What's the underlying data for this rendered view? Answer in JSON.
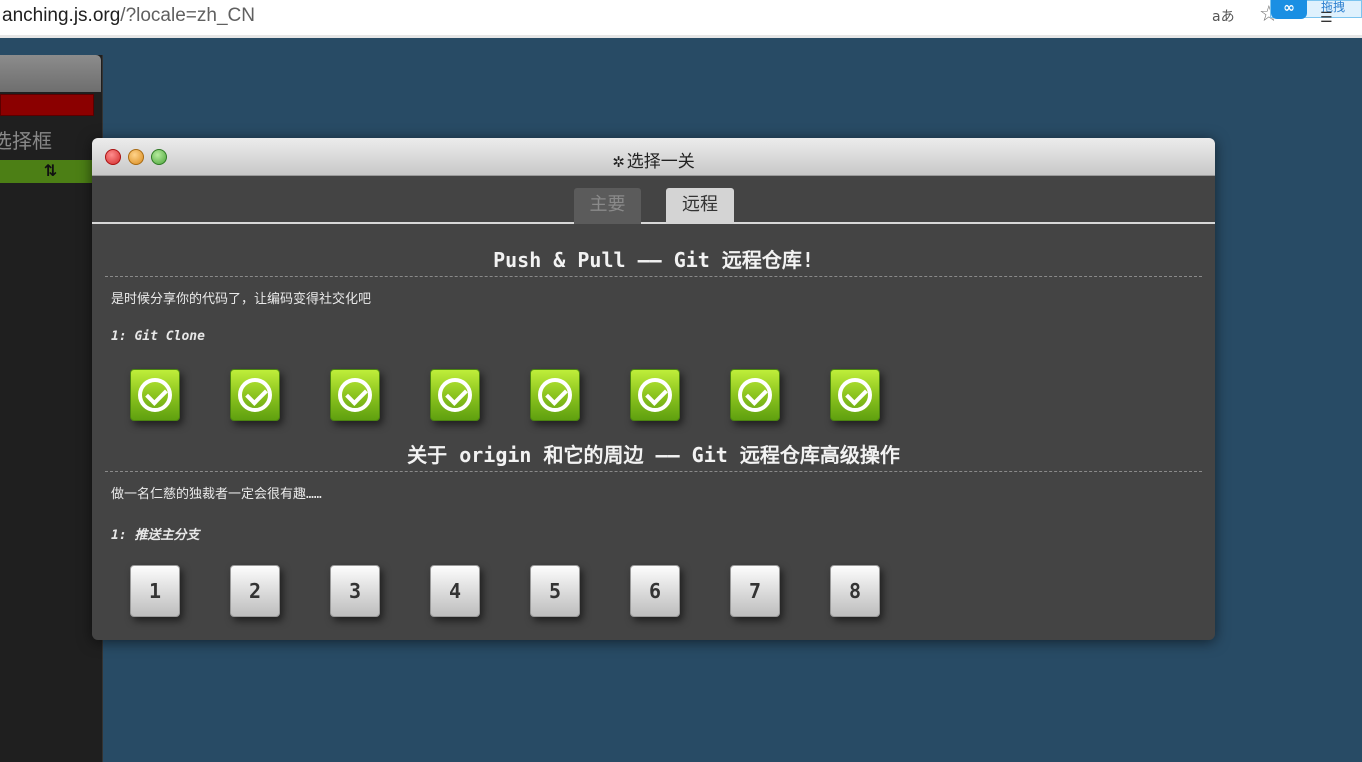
{
  "browser": {
    "url_host": "anching.js.org",
    "url_rest": "/?locale=zh_CN",
    "reader_icon": "aあ",
    "ext_text": "拖拽"
  },
  "left_panel": {
    "label": "选择框",
    "action_icon": "⇅"
  },
  "modal": {
    "title": "选择一关",
    "tabs": [
      {
        "label": "主要",
        "active": false
      },
      {
        "label": "远程",
        "active": true
      }
    ],
    "sections": [
      {
        "title": "Push & Pull —— Git 远程仓库!",
        "description": "是时候分享你的代码了，让编码变得社交化吧",
        "sequence": "1: Git Clone",
        "levels": [
          {
            "label": "1",
            "completed": true
          },
          {
            "label": "2",
            "completed": true
          },
          {
            "label": "3",
            "completed": true
          },
          {
            "label": "4",
            "completed": true
          },
          {
            "label": "5",
            "completed": true
          },
          {
            "label": "6",
            "completed": true
          },
          {
            "label": "7",
            "completed": true
          },
          {
            "label": "8",
            "completed": true
          }
        ]
      },
      {
        "title": "关于 origin 和它的周边 —— Git 远程仓库高级操作",
        "description": "做一名仁慈的独裁者一定会很有趣……",
        "sequence": "1: 推送主分支",
        "levels": [
          {
            "label": "1",
            "completed": false
          },
          {
            "label": "2",
            "completed": false
          },
          {
            "label": "3",
            "completed": false
          },
          {
            "label": "4",
            "completed": false
          },
          {
            "label": "5",
            "completed": false
          },
          {
            "label": "6",
            "completed": false
          },
          {
            "label": "7",
            "completed": false
          },
          {
            "label": "8",
            "completed": false
          }
        ]
      }
    ]
  },
  "colors": {
    "page_bg": "#284b65",
    "modal_bg": "#444444",
    "complete_green": "#8cc41f"
  }
}
